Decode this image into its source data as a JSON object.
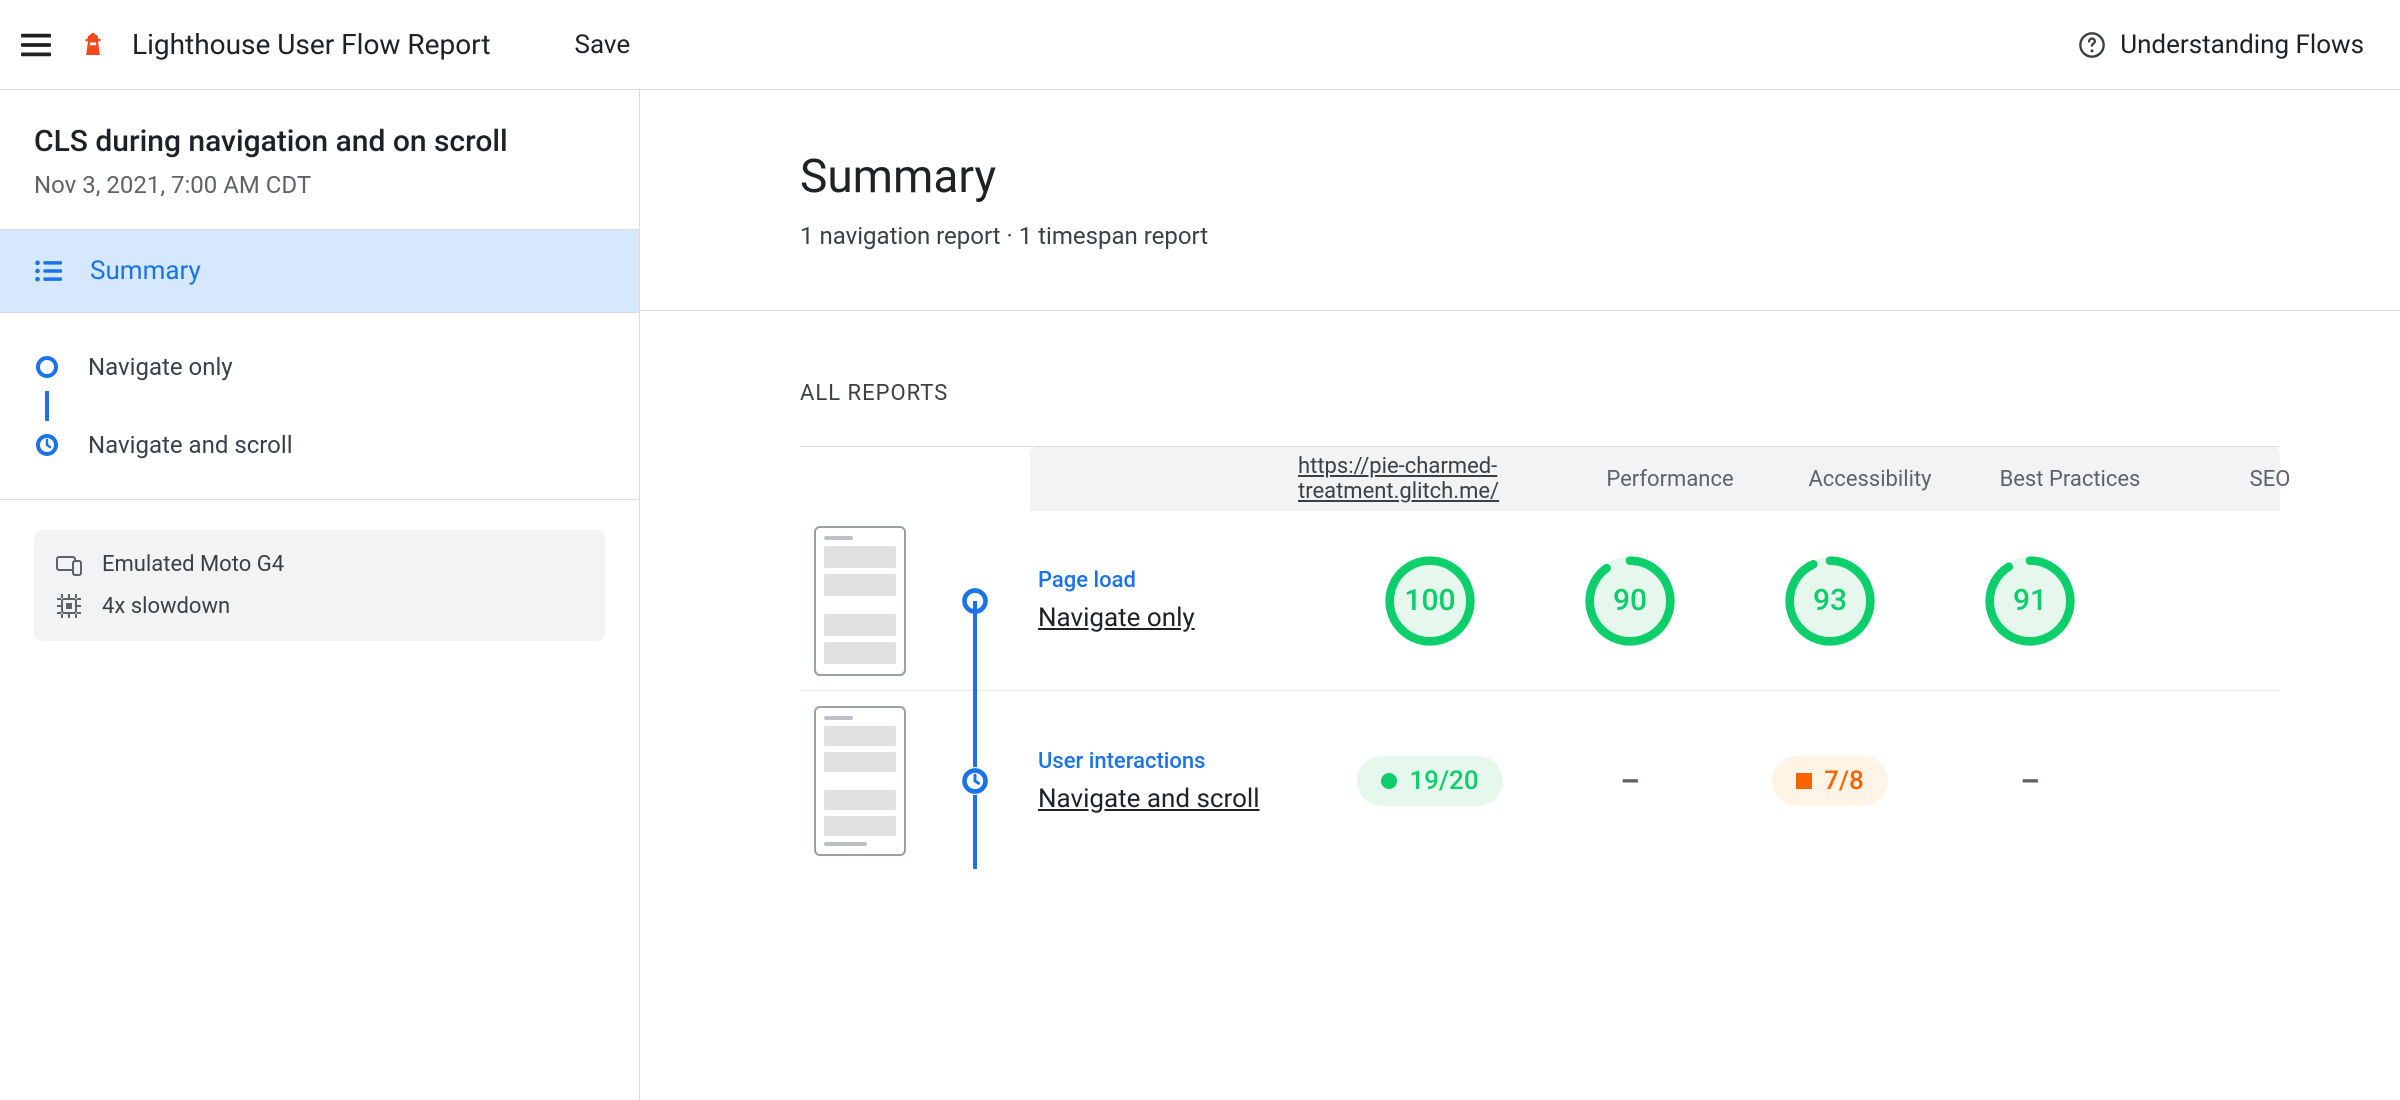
{
  "topbar": {
    "title": "Lighthouse User Flow Report",
    "save_label": "Save",
    "help_label": "Understanding Flows"
  },
  "sidebar": {
    "flow_title": "CLS during navigation and on scroll",
    "flow_date": "Nov 3, 2021, 7:00 AM CDT",
    "summary_label": "Summary",
    "steps": [
      {
        "label": "Navigate only",
        "icon": "nav-start-icon"
      },
      {
        "label": "Navigate and scroll",
        "icon": "timespan-icon"
      }
    ],
    "env": {
      "device": "Emulated Moto G4",
      "cpu": "4x slowdown"
    }
  },
  "main": {
    "summary_title": "Summary",
    "summary_subtitle": "1 navigation report · 1 timespan report",
    "all_reports_label": "ALL REPORTS",
    "columns": {
      "url": "https://pie-charmed-treatment.glitch.me/",
      "performance": "Performance",
      "accessibility": "Accessibility",
      "best_practices": "Best Practices",
      "seo": "SEO"
    },
    "rows": [
      {
        "type_label": "Page load",
        "name": "Navigate only",
        "mode": "navigation",
        "scores": {
          "performance": 100,
          "accessibility": 90,
          "best_practices": 93,
          "seo": 91
        }
      },
      {
        "type_label": "User interactions",
        "name": "Navigate and scroll",
        "mode": "timespan",
        "scores": {
          "performance": {
            "pass": 19,
            "total": 20,
            "level": "green"
          },
          "accessibility": null,
          "best_practices": {
            "pass": 7,
            "total": 8,
            "level": "orange"
          },
          "seo": null
        }
      }
    ]
  },
  "colors": {
    "blue": "#1a73e8",
    "green": "#0cce6b",
    "orange": "#fa6400"
  }
}
